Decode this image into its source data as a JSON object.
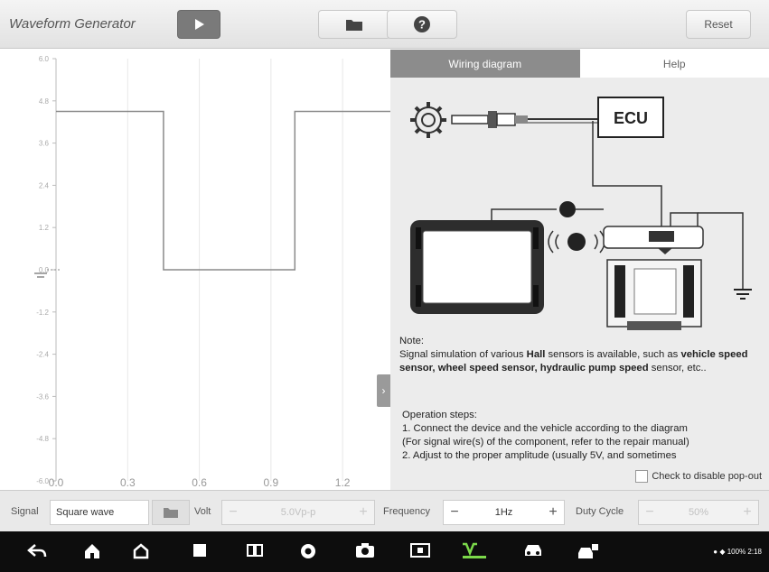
{
  "app": {
    "title": "Waveform Generator"
  },
  "toolbar": {
    "reset_label": "Reset",
    "icons": [
      "play-icon",
      "folder-icon",
      "help-icon"
    ]
  },
  "chart_data": {
    "type": "line",
    "title": "",
    "xlabel": "",
    "ylabel": "",
    "xlim": [
      0,
      1.4
    ],
    "ylim": [
      -6.0,
      6.0
    ],
    "y_ticks": [
      "6.0",
      "4.8",
      "3.6",
      "2.4",
      "1.2",
      "0.0",
      "-1.2",
      "-2.4",
      "-3.6",
      "-4.8",
      "-6.0"
    ],
    "x_ticks": [
      "0.0",
      "0.3",
      "0.6",
      "0.9",
      "1.2"
    ],
    "grid": true,
    "series": [
      {
        "x": [
          0.0,
          0.45,
          0.45,
          1.0,
          1.0,
          1.4
        ],
        "y": [
          4.5,
          4.5,
          0.0,
          0.0,
          4.5,
          4.5
        ]
      }
    ],
    "line_color": "#8a8a8a"
  },
  "panel": {
    "tabs": [
      {
        "label": "Wiring diagram",
        "active": true
      },
      {
        "label": "Help",
        "active": false
      }
    ],
    "diagram": {
      "ecu_label": "ECU"
    },
    "note_title": "Note:",
    "note_parts": {
      "p1": "Signal simulation of various ",
      "b1": "Hall",
      "p2": " sensors is available, such as ",
      "b2": "vehicle speed sensor, wheel speed sensor, hydraulic pump speed",
      "p3": " sensor, etc.."
    },
    "ops_title": "Operation steps:",
    "ops_lines": [
      "1. Connect the device and the vehicle according to the diagram",
      "(For signal wire(s) of the component, refer to the repair manual)",
      "2. Adjust to the proper amplitude (usually 5V, and sometimes"
    ],
    "checkbox_label": "Check to disable pop-out"
  },
  "controls": {
    "signal_label": "Signal",
    "signal_value": "Square wave",
    "volt_label": "Volt",
    "volt_value": "5.0Vp-p",
    "frequency_label": "Frequency",
    "frequency_value": "1Hz",
    "duty_label": "Duty Cycle",
    "duty_value": "50%"
  },
  "navbar": {
    "status_text": "100% 2:18"
  }
}
